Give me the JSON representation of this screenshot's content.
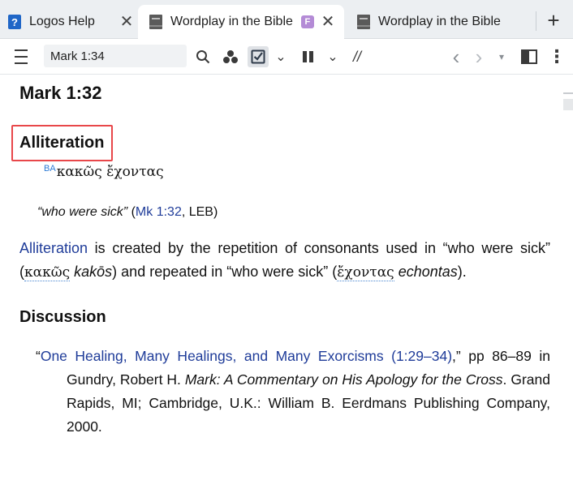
{
  "tabs": [
    {
      "label": "Logos Help",
      "icon": "question-help-icon",
      "close": "✕"
    },
    {
      "label": "Wordplay in the Bible",
      "icon": "book-icon",
      "badge": "F",
      "close": "✕"
    },
    {
      "label": "Wordplay in the Bible",
      "icon": "book-icon"
    }
  ],
  "tab_add_label": "+",
  "toolbar": {
    "reference_value": "Mark 1:34",
    "glyphs": {
      "chevron": "⌄",
      "parallel": "//",
      "back": "‹",
      "forward": "›",
      "caret": "▾",
      "more": "⋮"
    }
  },
  "content": {
    "heading": "Mark 1:32",
    "section_title": "Alliteration",
    "greek_marker": "BA",
    "greek_phrase": "κακῶς ἔχοντας",
    "quote": {
      "text": "“who were sick”",
      "open": "(",
      "ref": "Mk 1:32",
      "version": ", LEB)"
    },
    "paragraph": {
      "term_link": "Alliteration",
      "text1": " is created by the repetition of consonants used in “who were sick” (",
      "greek1": "κακῶς",
      "translit1": "kakōs",
      "text2": ") and repeated in “who were sick” (",
      "greek2": "ἔχοντας",
      "translit2": "echontas",
      "text3": ")."
    },
    "discussion_title": "Discussion",
    "bibliography": {
      "open_quote": "“",
      "link": "One Healing, Many Healings, and Many Exorcisms (1:29–34)",
      "after_link": ",” pp 86–89 in Gundry, Robert H. ",
      "title": "Mark: A Commentary on His Apology for the Cross",
      "rest": ". Grand Rapids, MI; Cambridge, U.K.: William B. Eerdmans Publishing Company, 2000."
    }
  },
  "colors": {
    "link": "#1f3c99",
    "highlight_box": "#e8474a",
    "tab_strip": "#eceff2",
    "help_icon": "#1f66c7",
    "f_badge": "#b48bd6"
  }
}
